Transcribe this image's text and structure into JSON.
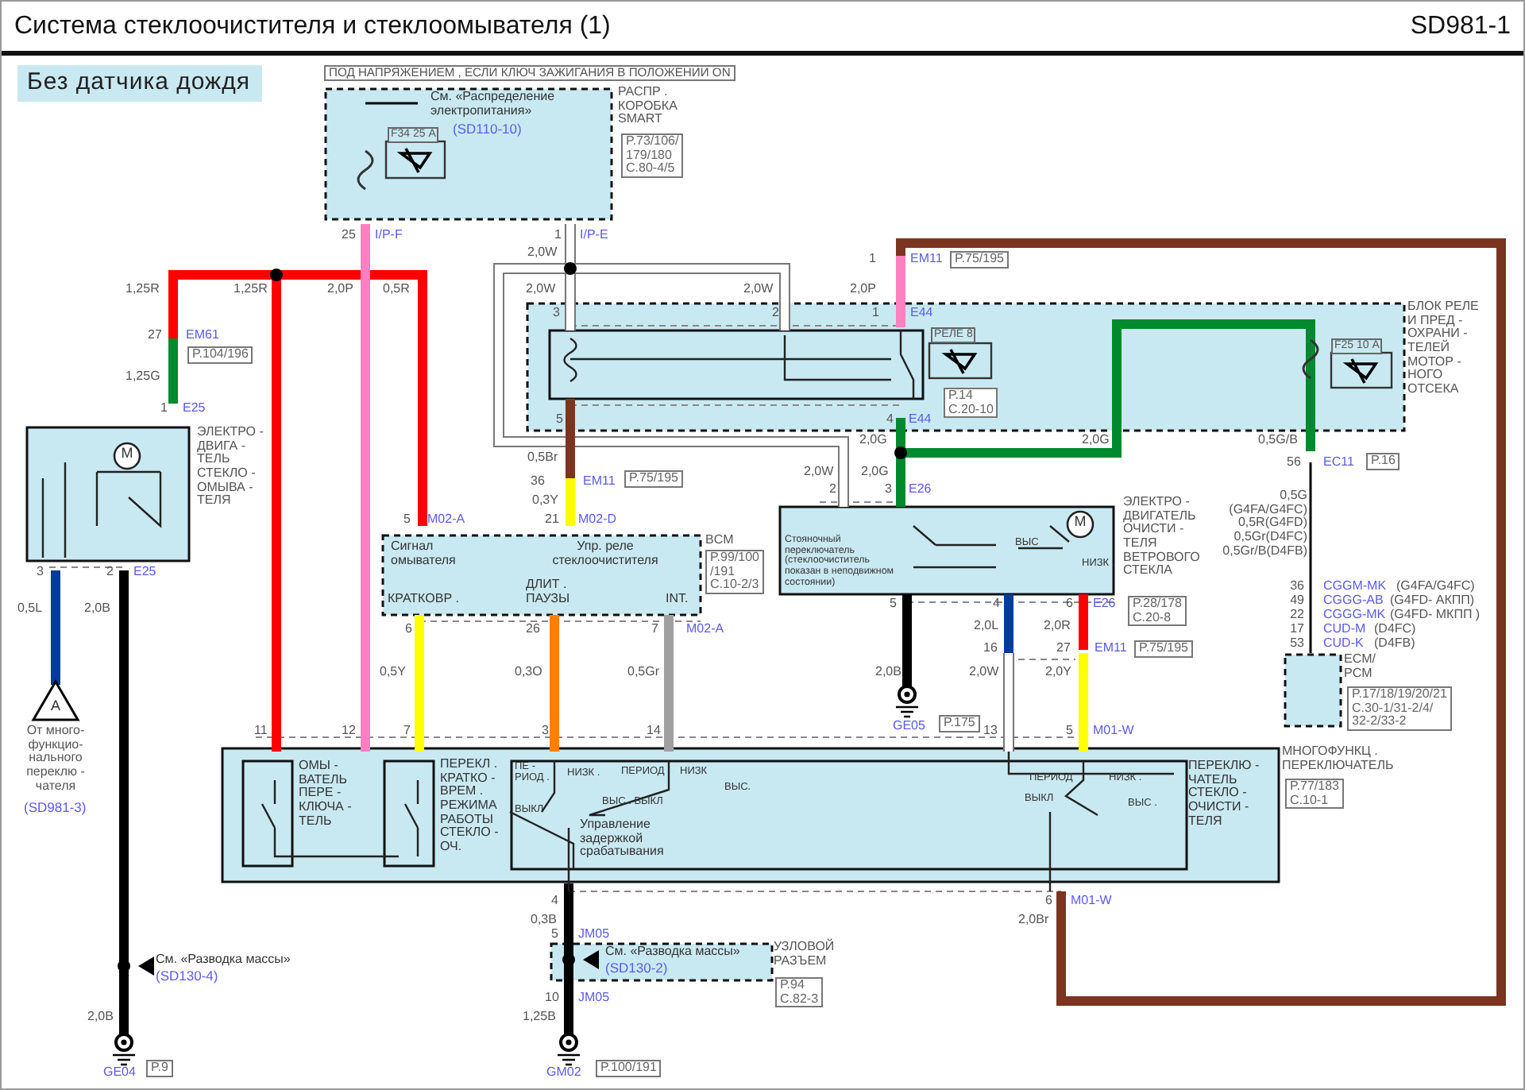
{
  "title": "Система стеклоочистителя и стеклоомывателя (1)",
  "sheet_code": "SD981-1",
  "labels": [
    {
      "kind": "banner",
      "text": "Без датчика дождя"
    },
    {
      "kind": "notice",
      "text": "ПОД НАПРЯЖЕНИЕМ , ЕСЛИ КЛЮЧ ЗАЖИГАНИЯ В ПОЛОЖЕНИИ ON"
    },
    {
      "kind": "note",
      "text": "См. «Распределение\nэлектропитания»"
    },
    {
      "kind": "link",
      "text": "(SD110-10)"
    },
    {
      "kind": "fuse",
      "text": "F34 25 А"
    },
    {
      "kind": "component",
      "text": "РАСПР .\nКОРОБКА\nSMART"
    },
    {
      "kind": "ref",
      "text": "P.73/106/\n179/180\nC.80-4/5"
    },
    {
      "kind": "pin",
      "text": "25"
    },
    {
      "kind": "connector",
      "text": "I/P-F"
    },
    {
      "kind": "pin",
      "text": "1"
    },
    {
      "kind": "connector",
      "text": "I/P-E"
    },
    {
      "kind": "wire",
      "text": "2,0W"
    },
    {
      "kind": "pin",
      "text": "1"
    },
    {
      "kind": "connector",
      "text": "EM11"
    },
    {
      "kind": "ref",
      "text": "P.75/195"
    },
    {
      "kind": "wire",
      "text": "1,25R"
    },
    {
      "kind": "wire",
      "text": "1,25R"
    },
    {
      "kind": "wire",
      "text": "2,0P"
    },
    {
      "kind": "wire",
      "text": "0,5R"
    },
    {
      "kind": "wire",
      "text": "2,0W"
    },
    {
      "kind": "wire",
      "text": "2,0W"
    },
    {
      "kind": "wire",
      "text": "2,0P"
    },
    {
      "kind": "pin",
      "text": "3"
    },
    {
      "kind": "pin",
      "text": "2"
    },
    {
      "kind": "pin",
      "text": "1"
    },
    {
      "kind": "connector",
      "text": "E44"
    },
    {
      "kind": "fuse",
      "text": "РЕЛЕ 8"
    },
    {
      "kind": "fuse",
      "text": "F25 10 А"
    },
    {
      "kind": "component",
      "text": "БЛОК РЕЛЕ\nИ ПРЕД -\nОХРАНИ -\nТЕЛЕЙ\nМОТОР -\nНОГО\nОТСЕКА"
    },
    {
      "kind": "pin",
      "text": "27"
    },
    {
      "kind": "connector",
      "text": "EM61"
    },
    {
      "kind": "ref",
      "text": "P.104/196"
    },
    {
      "kind": "wire",
      "text": "1,25G"
    },
    {
      "kind": "pin",
      "text": "1"
    },
    {
      "kind": "connector",
      "text": "E25"
    },
    {
      "kind": "ref",
      "text": "P.14\nC.20-10"
    },
    {
      "kind": "pin",
      "text": "5"
    },
    {
      "kind": "pin",
      "text": "4"
    },
    {
      "kind": "connector",
      "text": "E44"
    },
    {
      "kind": "component",
      "text": "ЭЛЕКТРО -\nДВИГА -\nТЕЛЬ\nСТЕКЛО -\nОМЫВА -\nТЕЛЯ"
    },
    {
      "kind": "wire",
      "text": "2,0G"
    },
    {
      "kind": "wire",
      "text": "2,0G"
    },
    {
      "kind": "wire",
      "text": "0,5G/B"
    },
    {
      "kind": "wire",
      "text": "0,5Br"
    },
    {
      "kind": "pin",
      "text": "56"
    },
    {
      "kind": "connector",
      "text": "EC11"
    },
    {
      "kind": "ref",
      "text": "P.16"
    },
    {
      "kind": "wire",
      "text": "2,0W"
    },
    {
      "kind": "wire",
      "text": "2,0G"
    },
    {
      "kind": "pin",
      "text": "36"
    },
    {
      "kind": "connector",
      "text": "EM11"
    },
    {
      "kind": "ref",
      "text": "P.75/195"
    },
    {
      "kind": "pin",
      "text": "2"
    },
    {
      "kind": "pin",
      "text": "3"
    },
    {
      "kind": "connector",
      "text": "E26"
    },
    {
      "kind": "wire",
      "text": "0,3Y"
    },
    {
      "kind": "pin",
      "text": "5"
    },
    {
      "kind": "connector",
      "text": "M02-A"
    },
    {
      "kind": "pin",
      "text": "21"
    },
    {
      "kind": "connector",
      "text": "M02-D"
    },
    {
      "kind": "component",
      "text": "ЭЛЕКТРО -\nДВИГАТЕЛЬ\nОЧИСТИ -\nТЕЛЯ\nВЕТРОВОГО\nСТЕКЛА"
    },
    {
      "kind": "wire",
      "text": "0,5G\n(G4FA/G4FC)\n0,5R(G4FD)\n0,5Gr(D4FC)\n0,5Gr/B(D4FB)"
    },
    {
      "kind": "note",
      "text": "Сигнал\nомывателя"
    },
    {
      "kind": "note",
      "text": "Упр. реле\nстеклоочистителя"
    },
    {
      "kind": "component",
      "text": "BCM"
    },
    {
      "kind": "ref",
      "text": "P.99/100\n/191\nC.10-2/3"
    },
    {
      "kind": "small",
      "text": "Стояночный\nпереключатель\n(стеклоочиститель\nпоказан в неподвижном\nсостоянии)"
    },
    {
      "kind": "switch",
      "text": "ВЫС"
    },
    {
      "kind": "switch",
      "text": "НИЗК ."
    },
    {
      "kind": "note",
      "text": "КРАТКОВР ."
    },
    {
      "kind": "note",
      "text": "ДЛИТ .\nПАУЗЫ"
    },
    {
      "kind": "note",
      "text": "INT."
    },
    {
      "kind": "ref",
      "text": "P.28/178\nC.20-8"
    },
    {
      "kind": "pin",
      "text": "36"
    },
    {
      "kind": "connector",
      "text": "CGGM-MK"
    },
    {
      "kind": "wire",
      "text": "(G4FA/G4FC)"
    },
    {
      "kind": "pin",
      "text": "49"
    },
    {
      "kind": "connector",
      "text": "CGGG-AB"
    },
    {
      "kind": "wire",
      "text": "(G4FD- АКПП)"
    },
    {
      "kind": "pin",
      "text": "22"
    },
    {
      "kind": "connector",
      "text": "CGGG-MK"
    },
    {
      "kind": "wire",
      "text": "(G4FD- МКПП )"
    },
    {
      "kind": "pin",
      "text": "17"
    },
    {
      "kind": "connector",
      "text": "CUD-M"
    },
    {
      "kind": "wire",
      "text": "(D4FC)"
    },
    {
      "kind": "pin",
      "text": "53"
    },
    {
      "kind": "connector",
      "text": "CUD-K"
    },
    {
      "kind": "wire",
      "text": "(D4FB)"
    },
    {
      "kind": "component",
      "text": "ECM/\nPCM"
    },
    {
      "kind": "ref",
      "text": "P.17/18/19/20/21\nC.30-1/31-2/4/\n32-2/33-2"
    },
    {
      "kind": "pin",
      "text": "3"
    },
    {
      "kind": "pin",
      "text": "2"
    },
    {
      "kind": "connector",
      "text": "E25"
    },
    {
      "kind": "pin",
      "text": "6"
    },
    {
      "kind": "pin",
      "text": "26"
    },
    {
      "kind": "pin",
      "text": "7"
    },
    {
      "kind": "connector",
      "text": "M02-A"
    },
    {
      "kind": "pin",
      "text": "5"
    },
    {
      "kind": "pin",
      "text": "4"
    },
    {
      "kind": "pin",
      "text": "6"
    },
    {
      "kind": "connector",
      "text": "E26"
    },
    {
      "kind": "wire",
      "text": "0,5L"
    },
    {
      "kind": "wire",
      "text": "2,0B"
    },
    {
      "kind": "wire",
      "text": "2,0L"
    },
    {
      "kind": "wire",
      "text": "2,0R"
    },
    {
      "kind": "pin",
      "text": "16"
    },
    {
      "kind": "pin",
      "text": "27"
    },
    {
      "kind": "connector",
      "text": "EM11"
    },
    {
      "kind": "ref",
      "text": "P.75/195"
    },
    {
      "kind": "wire",
      "text": "0,5Y"
    },
    {
      "kind": "wire",
      "text": "0,3O"
    },
    {
      "kind": "wire",
      "text": "0,5Gr"
    },
    {
      "kind": "wire",
      "text": "2,0B"
    },
    {
      "kind": "wire",
      "text": "2,0W"
    },
    {
      "kind": "wire",
      "text": "2,0Y"
    },
    {
      "kind": "mark",
      "text": "A"
    },
    {
      "kind": "component",
      "text": "От много-\nфункцио-\nнального\nпереклю -\nчателя"
    },
    {
      "kind": "link",
      "text": "(SD981-3)"
    },
    {
      "kind": "connector",
      "text": "GE05"
    },
    {
      "kind": "ref",
      "text": "P.175"
    },
    {
      "kind": "pin",
      "text": "11"
    },
    {
      "kind": "pin",
      "text": "12"
    },
    {
      "kind": "pin",
      "text": "7"
    },
    {
      "kind": "pin",
      "text": "3"
    },
    {
      "kind": "pin",
      "text": "14"
    },
    {
      "kind": "pin",
      "text": "13"
    },
    {
      "kind": "pin",
      "text": "5"
    },
    {
      "kind": "connector",
      "text": "M01-W"
    },
    {
      "kind": "component",
      "text": "МНОГОФУНКЦ .\nПЕРЕКЛЮЧАТЕЛЬ"
    },
    {
      "kind": "note",
      "text": "ОМЫ -\nВАТЕЛЬ\nПЕРЕ -\nКЛЮЧА -\nТЕЛЬ"
    },
    {
      "kind": "note",
      "text": "ПЕРЕКЛ .\nКРАТКО -\nВРЕМ .\nРЕЖИМА\nРАБОТЫ\nСТЕКЛО -\nОЧ."
    },
    {
      "kind": "switch",
      "text": "ПЕ -\nРИОД ."
    },
    {
      "kind": "switch",
      "text": "НИЗК ."
    },
    {
      "kind": "switch",
      "text": "ПЕРИОД"
    },
    {
      "kind": "switch",
      "text": "НИЗК"
    },
    {
      "kind": "switch",
      "text": "ВЫС . ВЫКЛ"
    },
    {
      "kind": "switch",
      "text": "ВЫС."
    },
    {
      "kind": "switch",
      "text": "ВЫКЛ"
    },
    {
      "kind": "note",
      "text": "Управление\nзадержкой\nсрабатывания"
    },
    {
      "kind": "switch",
      "text": "ПЕРИОД"
    },
    {
      "kind": "switch",
      "text": "НИЗК ."
    },
    {
      "kind": "switch",
      "text": "ВЫКЛ"
    },
    {
      "kind": "switch",
      "text": "ВЫС ."
    },
    {
      "kind": "note",
      "text": "ПЕРЕКЛЮ -\nЧАТЕЛЬ\nСТЕКЛО -\nОЧИСТИ -\nТЕЛЯ"
    },
    {
      "kind": "ref",
      "text": "P.77/183\nC.10-1"
    },
    {
      "kind": "pin",
      "text": "4"
    },
    {
      "kind": "pin",
      "text": "6"
    },
    {
      "kind": "connector",
      "text": "M01-W"
    },
    {
      "kind": "wire",
      "text": "0,3B"
    },
    {
      "kind": "wire",
      "text": "2,0Br"
    },
    {
      "kind": "pin",
      "text": "5"
    },
    {
      "kind": "connector",
      "text": "JM05"
    },
    {
      "kind": "note",
      "text": "См. «Разводка массы»"
    },
    {
      "kind": "link",
      "text": "(SD130-4)"
    },
    {
      "kind": "note",
      "text": "См. «Разводка массы»"
    },
    {
      "kind": "link",
      "text": "(SD130-2)"
    },
    {
      "kind": "component",
      "text": "УЗЛОВОЙ\nРАЗЪЕМ"
    },
    {
      "kind": "pin",
      "text": "10"
    },
    {
      "kind": "connector",
      "text": "JM05"
    },
    {
      "kind": "wire",
      "text": "2,0B"
    },
    {
      "kind": "wire",
      "text": "1,25B"
    },
    {
      "kind": "ref",
      "text": "P.94\nC.82-3"
    },
    {
      "kind": "connector",
      "text": "GE04"
    },
    {
      "kind": "ref",
      "text": "P.9"
    },
    {
      "kind": "connector",
      "text": "GM02"
    },
    {
      "kind": "ref",
      "text": "P.100/191"
    },
    {
      "kind": "mark",
      "text": "M"
    },
    {
      "kind": "mark",
      "text": "M"
    }
  ]
}
